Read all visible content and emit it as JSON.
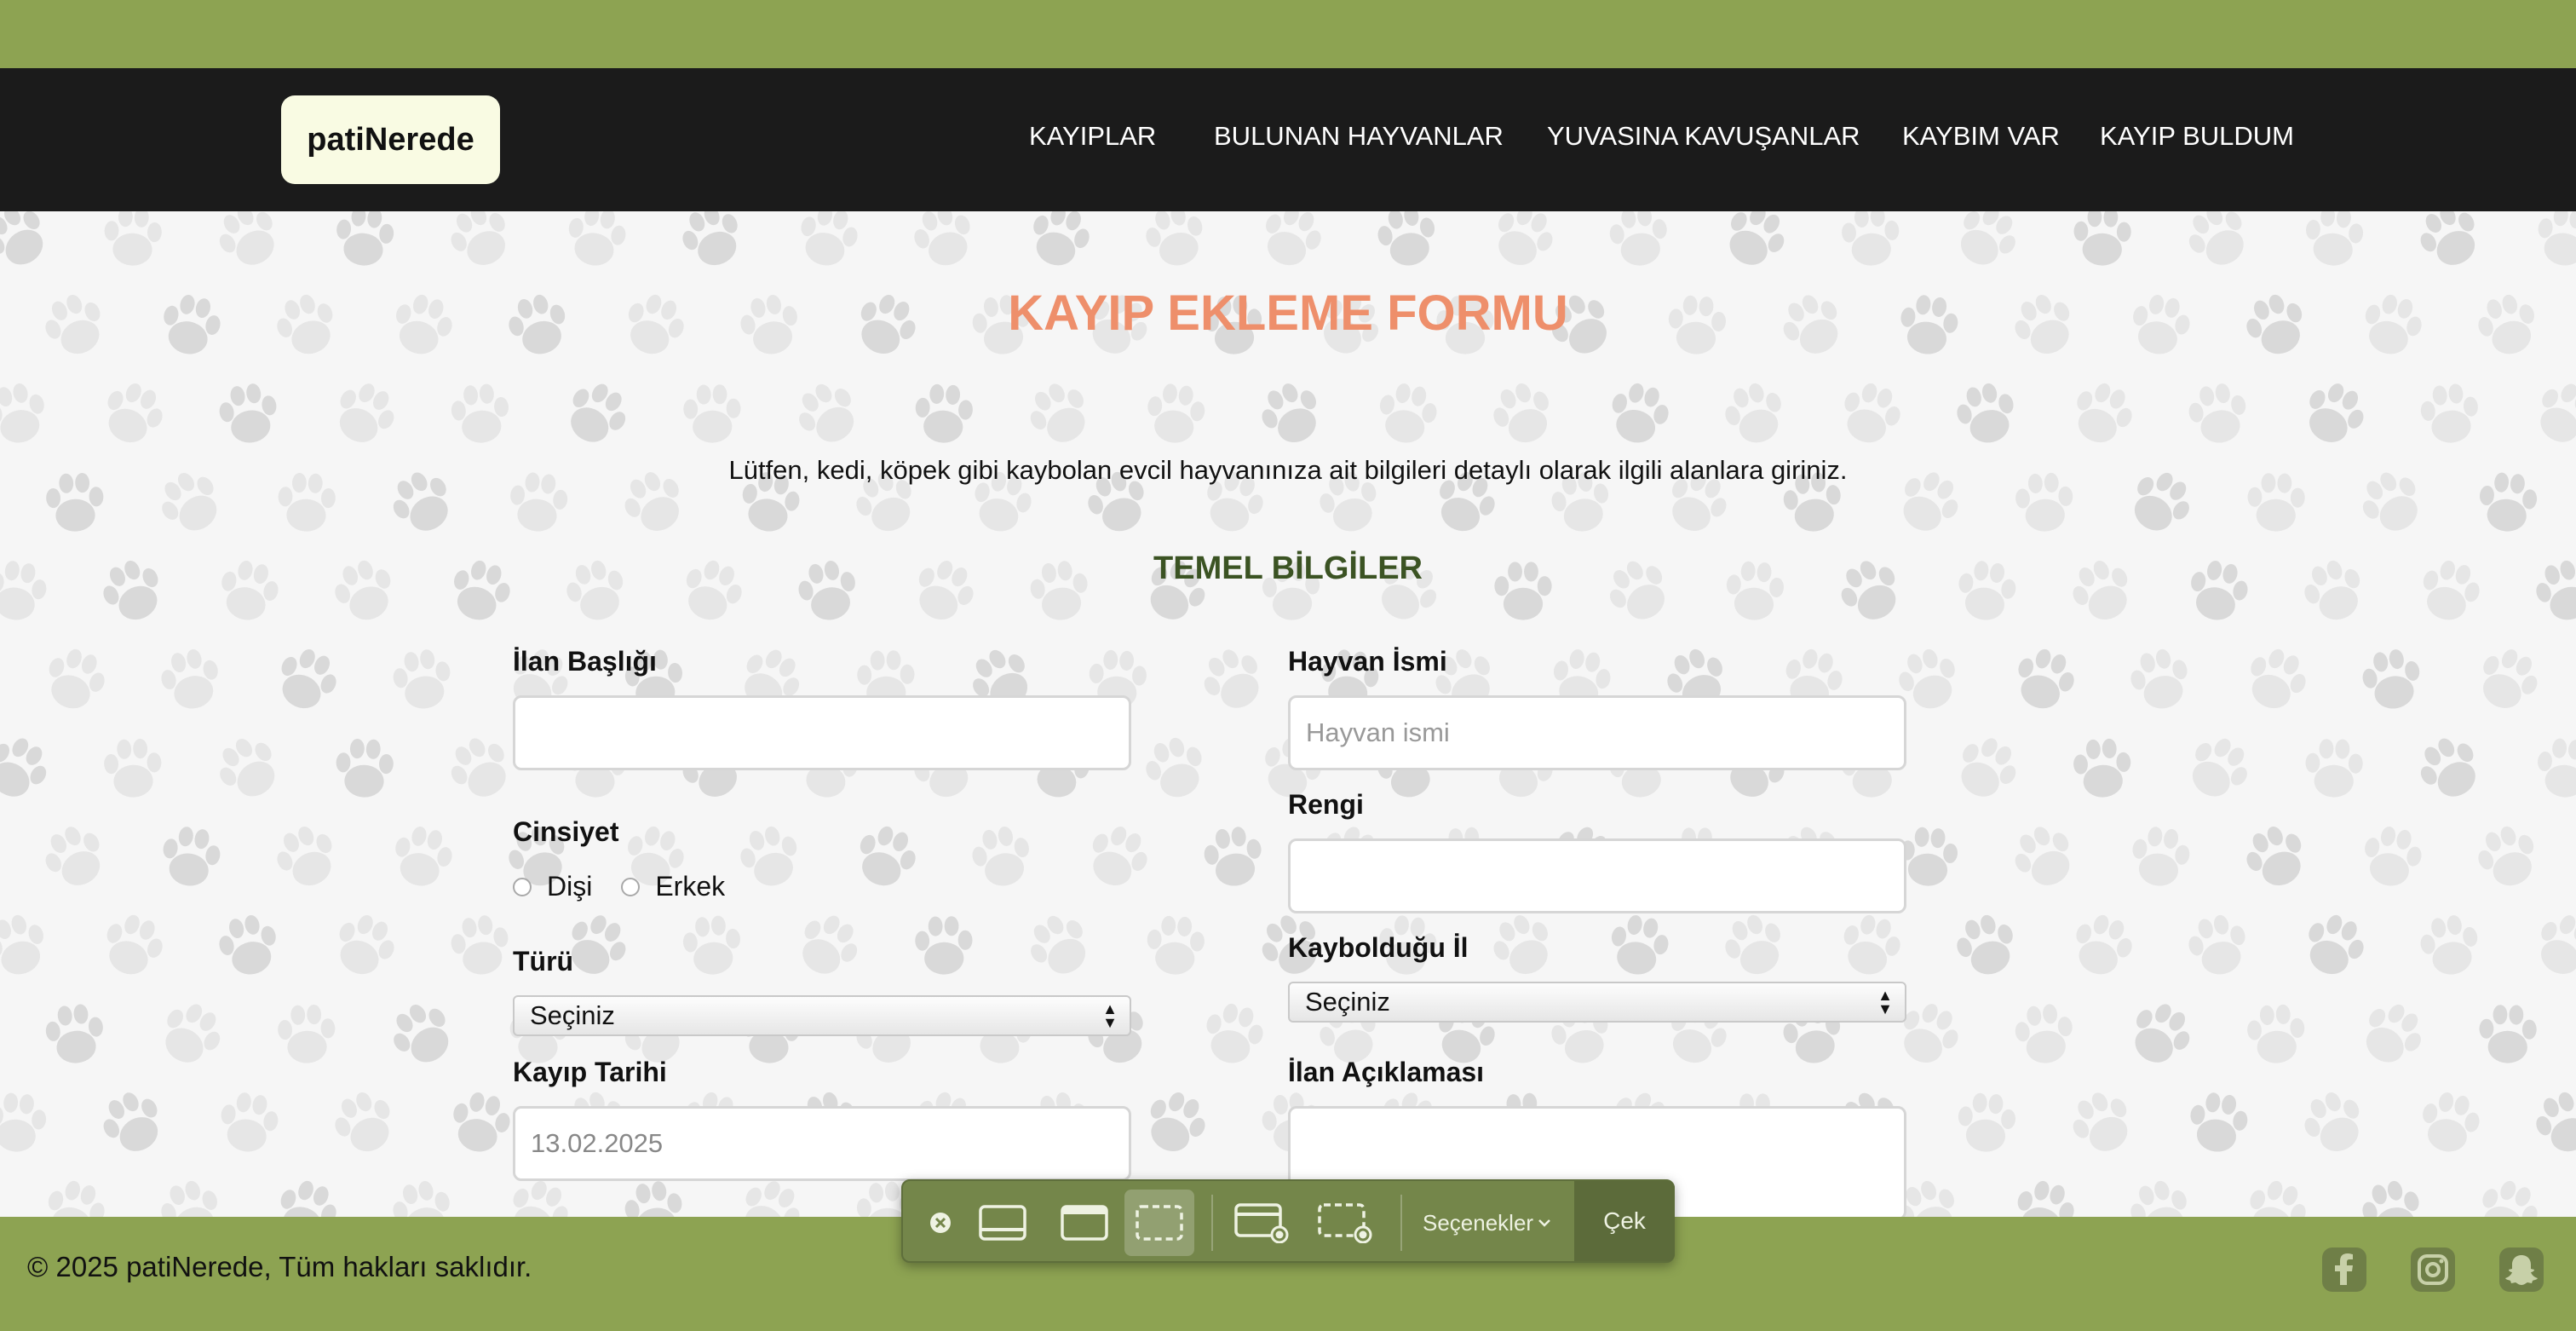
{
  "header": {
    "logo": "patiNerede",
    "nav": [
      "KAYIPLAR",
      "BULUNAN HAYVANLAR",
      "YUVASINA KAVUŞANLAR",
      "KAYBIM VAR",
      "KAYIP BULDUM"
    ]
  },
  "form": {
    "title": "KAYIP EKLEME FORMU",
    "intro": "Lütfen, kedi, köpek gibi kaybolan evcil hayvanınıza ait bilgileri detaylı olarak ilgili alanlara giriniz.",
    "section": "TEMEL BİLGİLER",
    "listing_title_label": "İlan Başlığı",
    "listing_title_value": "",
    "animal_name_label": "Hayvan İsmi",
    "animal_name_placeholder": "Hayvan ismi",
    "gender_label": "Cinsiyet",
    "gender_options": [
      "Dişi",
      "Erkek"
    ],
    "color_label": "Rengi",
    "type_label": "Türü",
    "type_selected": "Seçiniz",
    "city_label": "Kaybolduğu İl",
    "city_selected": "Seçiniz",
    "date_label": "Kayıp Tarihi",
    "date_value": "13.02.2025",
    "description_label": "İlan Açıklaması"
  },
  "footer": {
    "copyright": "© 2025 patiNerede, Tüm hakları saklıdır.",
    "social_icons": [
      "facebook-icon",
      "instagram-icon",
      "snapchat-icon"
    ]
  },
  "screenshot_toolbar": {
    "options_label": "Seçenekler",
    "capture_label": "Çek"
  },
  "colors": {
    "accent_green": "#8da352",
    "navbar": "#1b1b1b",
    "title_orange": "#ee8f6b",
    "section_green": "#3b5323"
  }
}
